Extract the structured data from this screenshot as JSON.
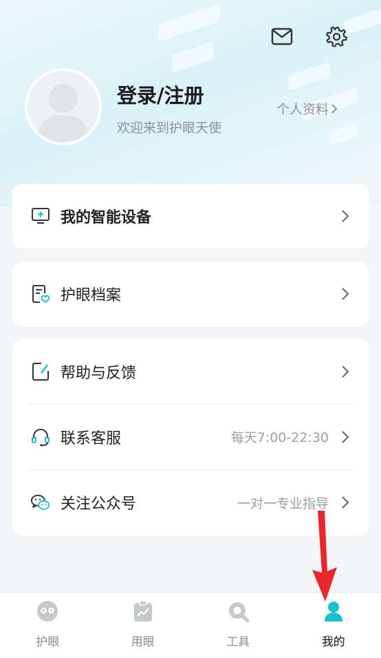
{
  "header": {
    "mail_icon": "mail-icon",
    "settings_icon": "gear-icon"
  },
  "profile": {
    "login_label": "登录/注册",
    "welcome_text": "欢迎来到护眼天使",
    "profile_link_label": "个人资料",
    "avatar_icon": "user-placeholder-icon"
  },
  "menu": {
    "devices": {
      "label": "我的智能设备",
      "icon": "monitor-plus-icon"
    },
    "eye_records": {
      "label": "护眼档案",
      "icon": "document-heart-icon"
    },
    "help_feedback": {
      "label": "帮助与反馈",
      "icon": "edit-icon"
    },
    "customer_service": {
      "label": "联系客服",
      "sub": "每天7:00-22:30",
      "icon": "headset-icon"
    },
    "official_account": {
      "label": "关注公众号",
      "sub": "一对一专业指导",
      "icon": "wechat-icon"
    }
  },
  "tabbar": {
    "tabs": [
      {
        "label": "护眼",
        "icon": "eye-mascot-icon",
        "active": false
      },
      {
        "label": "用眼",
        "icon": "chart-clipboard-icon",
        "active": false
      },
      {
        "label": "工具",
        "icon": "search-tool-icon",
        "active": false
      },
      {
        "label": "我的",
        "icon": "person-icon",
        "active": true
      }
    ]
  },
  "colors": {
    "accent": "#17c1d0",
    "annotation_arrow": "#e8262d",
    "tab_inactive": "#c5c9cc",
    "background": "#f3f5f8"
  }
}
